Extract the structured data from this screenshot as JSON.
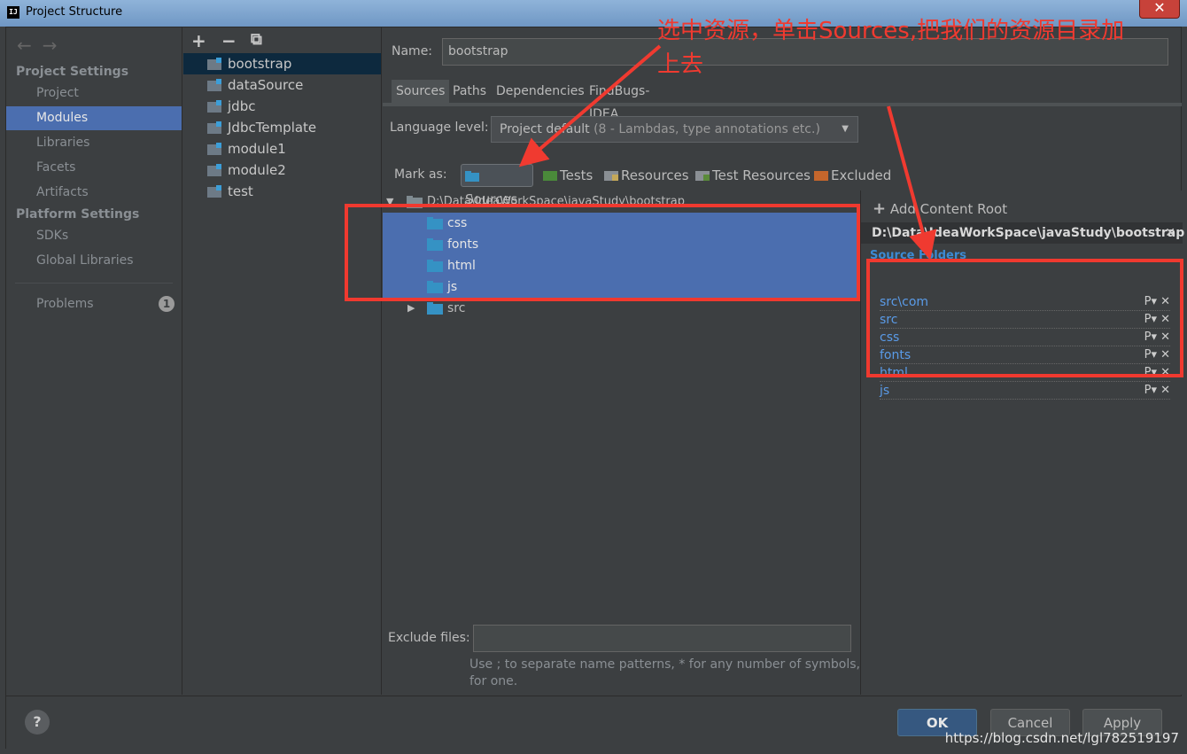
{
  "window": {
    "title": "Project Structure",
    "close": "✕"
  },
  "sidebar": {
    "sections": [
      {
        "title": "Project Settings"
      },
      {
        "title": "Platform Settings"
      }
    ],
    "items": [
      {
        "label": "Project"
      },
      {
        "label": "Modules",
        "selected": true
      },
      {
        "label": "Libraries"
      },
      {
        "label": "Facets"
      },
      {
        "label": "Artifacts"
      },
      {
        "label": "SDKs"
      },
      {
        "label": "Global Libraries"
      },
      {
        "label": "Problems",
        "badge": "1"
      }
    ]
  },
  "modules": {
    "toolbar": {
      "add": "+",
      "remove": "−",
      "copy": "⧉"
    },
    "items": [
      {
        "label": "bootstrap",
        "selected": true
      },
      {
        "label": "dataSource"
      },
      {
        "label": "jdbc"
      },
      {
        "label": "JdbcTemplate"
      },
      {
        "label": "module1"
      },
      {
        "label": "module2"
      },
      {
        "label": "test"
      }
    ]
  },
  "details": {
    "name_label": "Name:",
    "name_value": "bootstrap",
    "tabs": [
      "Sources",
      "Paths",
      "Dependencies",
      "FindBugs-IDEA"
    ],
    "language_label": "Language level:",
    "language_value": "Project default",
    "language_hint": "(8 - Lambdas, type annotations etc.)",
    "mark_as_label": "Mark as:",
    "mark_buttons": [
      "Sources",
      "Tests",
      "Resources",
      "Test Resources",
      "Excluded"
    ],
    "mark_colors": {
      "sources": "#3592c4",
      "tests": "#4a8a3a",
      "resources": "#8a8f94",
      "excluded": "#c4662c"
    }
  },
  "tree": {
    "root": "D:\\Data\\IdeaWorkSpace\\javaStudy\\bootstrap",
    "children": [
      {
        "label": "css",
        "selected": true
      },
      {
        "label": "fonts",
        "selected": true
      },
      {
        "label": "html",
        "selected": true
      },
      {
        "label": "js",
        "selected": true
      },
      {
        "label": "src",
        "selected": false
      }
    ]
  },
  "exclude": {
    "label": "Exclude files:",
    "value": "",
    "help_line1": "Use ; to separate name patterns, * for any number of symbols, ?",
    "help_line2": "for one."
  },
  "content_root": {
    "add_label": "Add Content Root",
    "path": "D:\\Data\\IdeaWorkSpace\\javaStudy\\bootstrap",
    "source_folders_title": "Source Folders",
    "source_folders": [
      "src\\com",
      "src",
      "css",
      "fonts",
      "html",
      "js"
    ],
    "row_actions": "P▾ ✕"
  },
  "footer": {
    "help": "?",
    "ok": "OK",
    "cancel": "Cancel",
    "apply": "Apply"
  },
  "annotation": {
    "line1": "选中资源，单击Sources,把我们的资源目录加",
    "line2": "上去",
    "color": "#f03a30"
  },
  "watermark": "https://blog.csdn.net/lgl782519197"
}
